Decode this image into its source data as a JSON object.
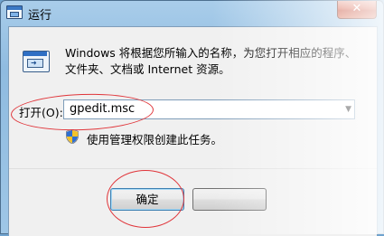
{
  "window": {
    "title": "运行",
    "close_label": "✕"
  },
  "description": "Windows 将根据您所输入的名称，为您打开相应的程序、文件夹、文档或 Internet 资源。",
  "open_field": {
    "label": "打开(O):",
    "value": "gpedit.msc"
  },
  "admin_note": "使用管理权限创建此任务。",
  "buttons": {
    "ok_label": "确定",
    "cancel_label": ""
  },
  "annotation_color": "#e0353a"
}
